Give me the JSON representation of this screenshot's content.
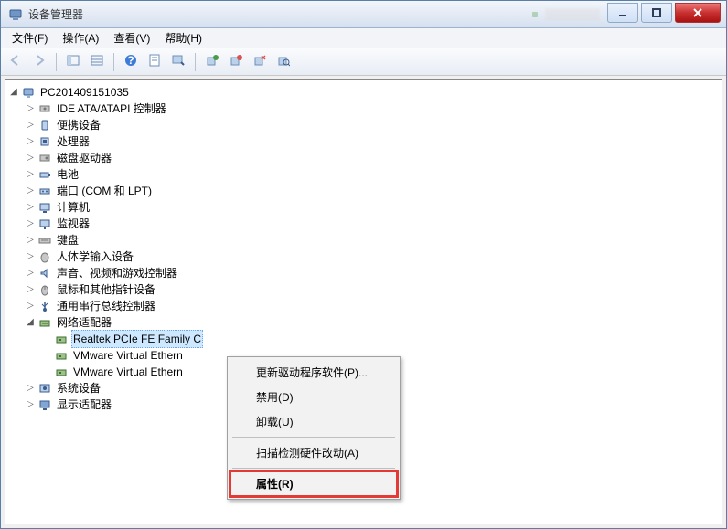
{
  "window": {
    "title": "设备管理器"
  },
  "menubar": {
    "file": "文件(F)",
    "action": "操作(A)",
    "view": "查看(V)",
    "help": "帮助(H)"
  },
  "toolbar_icons": {
    "back": "back-icon",
    "forward": "forward-icon",
    "up": "up-icon",
    "show_hidden": "show-hidden-icon",
    "help": "help-icon",
    "properties": "properties-icon",
    "find": "find-icon",
    "enable": "enable-icon",
    "disable": "disable-icon",
    "scan": "scan-icon"
  },
  "tree": {
    "root": {
      "label": "PC201409151035",
      "expanded": true
    },
    "nodes": [
      {
        "label": "IDE ATA/ATAPI 控制器",
        "icon": "ide"
      },
      {
        "label": "便携设备",
        "icon": "portable"
      },
      {
        "label": "处理器",
        "icon": "cpu"
      },
      {
        "label": "磁盘驱动器",
        "icon": "disk"
      },
      {
        "label": "电池",
        "icon": "battery"
      },
      {
        "label": "端口 (COM 和 LPT)",
        "icon": "port"
      },
      {
        "label": "计算机",
        "icon": "computer"
      },
      {
        "label": "监视器",
        "icon": "monitor"
      },
      {
        "label": "键盘",
        "icon": "keyboard"
      },
      {
        "label": "人体学输入设备",
        "icon": "hid"
      },
      {
        "label": "声音、视频和游戏控制器",
        "icon": "sound"
      },
      {
        "label": "鼠标和其他指针设备",
        "icon": "mouse"
      },
      {
        "label": "通用串行总线控制器",
        "icon": "usb"
      },
      {
        "label": "网络适配器",
        "icon": "network",
        "expanded": true,
        "children": [
          {
            "label": "Realtek PCIe FE Family Controller",
            "icon": "nic",
            "selected": true,
            "truncated_label": "Realtek PCIe FE Family C"
          },
          {
            "label": "VMware Virtual Ethern",
            "icon": "nic"
          },
          {
            "label": "VMware Virtual Ethern",
            "icon": "nic"
          }
        ]
      },
      {
        "label": "系统设备",
        "icon": "system"
      },
      {
        "label": "显示适配器",
        "icon": "display"
      }
    ]
  },
  "context_menu": {
    "items": [
      {
        "label": "更新驱动程序软件(P)...",
        "key": "update-driver"
      },
      {
        "label": "禁用(D)",
        "key": "disable"
      },
      {
        "label": "卸载(U)",
        "key": "uninstall"
      },
      {
        "sep": true
      },
      {
        "label": "扫描检测硬件改动(A)",
        "key": "scan-hardware"
      },
      {
        "sep": true
      },
      {
        "label": "属性(R)",
        "key": "properties",
        "highlighted": true
      }
    ]
  }
}
